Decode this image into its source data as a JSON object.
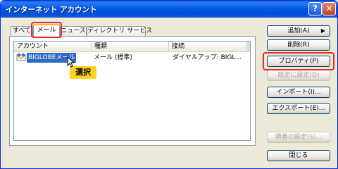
{
  "window": {
    "title": "インターネット アカウント",
    "help_label": "?",
    "close_label": "✕"
  },
  "tabs": [
    {
      "label": "すべて"
    },
    {
      "label": "メール",
      "active": true
    },
    {
      "label": "ニュース"
    },
    {
      "label": "ディレクトリ サービス"
    }
  ],
  "list": {
    "columns": [
      "アカウント",
      "種類",
      "接続"
    ],
    "rows": [
      {
        "account": "BIGLOBEメール",
        "type": "メール (標準)",
        "connection": "ダイヤルアップ: BIGL..."
      }
    ]
  },
  "callout": {
    "label": "選択"
  },
  "buttons": {
    "add": "追加(A)",
    "add_arrow": "▶",
    "remove": "削除(R)",
    "properties": "プロパティ(P)",
    "set_default": "既定に設定(D)",
    "import": "インポート(I)...",
    "export": "エクスポート(E)...",
    "set_order": "順番の設定(S)...",
    "close": "閉じる"
  },
  "colors": {
    "selection": "#316ac5",
    "highlight_box": "#e8291c",
    "callout_bg": "#ffd21f"
  }
}
